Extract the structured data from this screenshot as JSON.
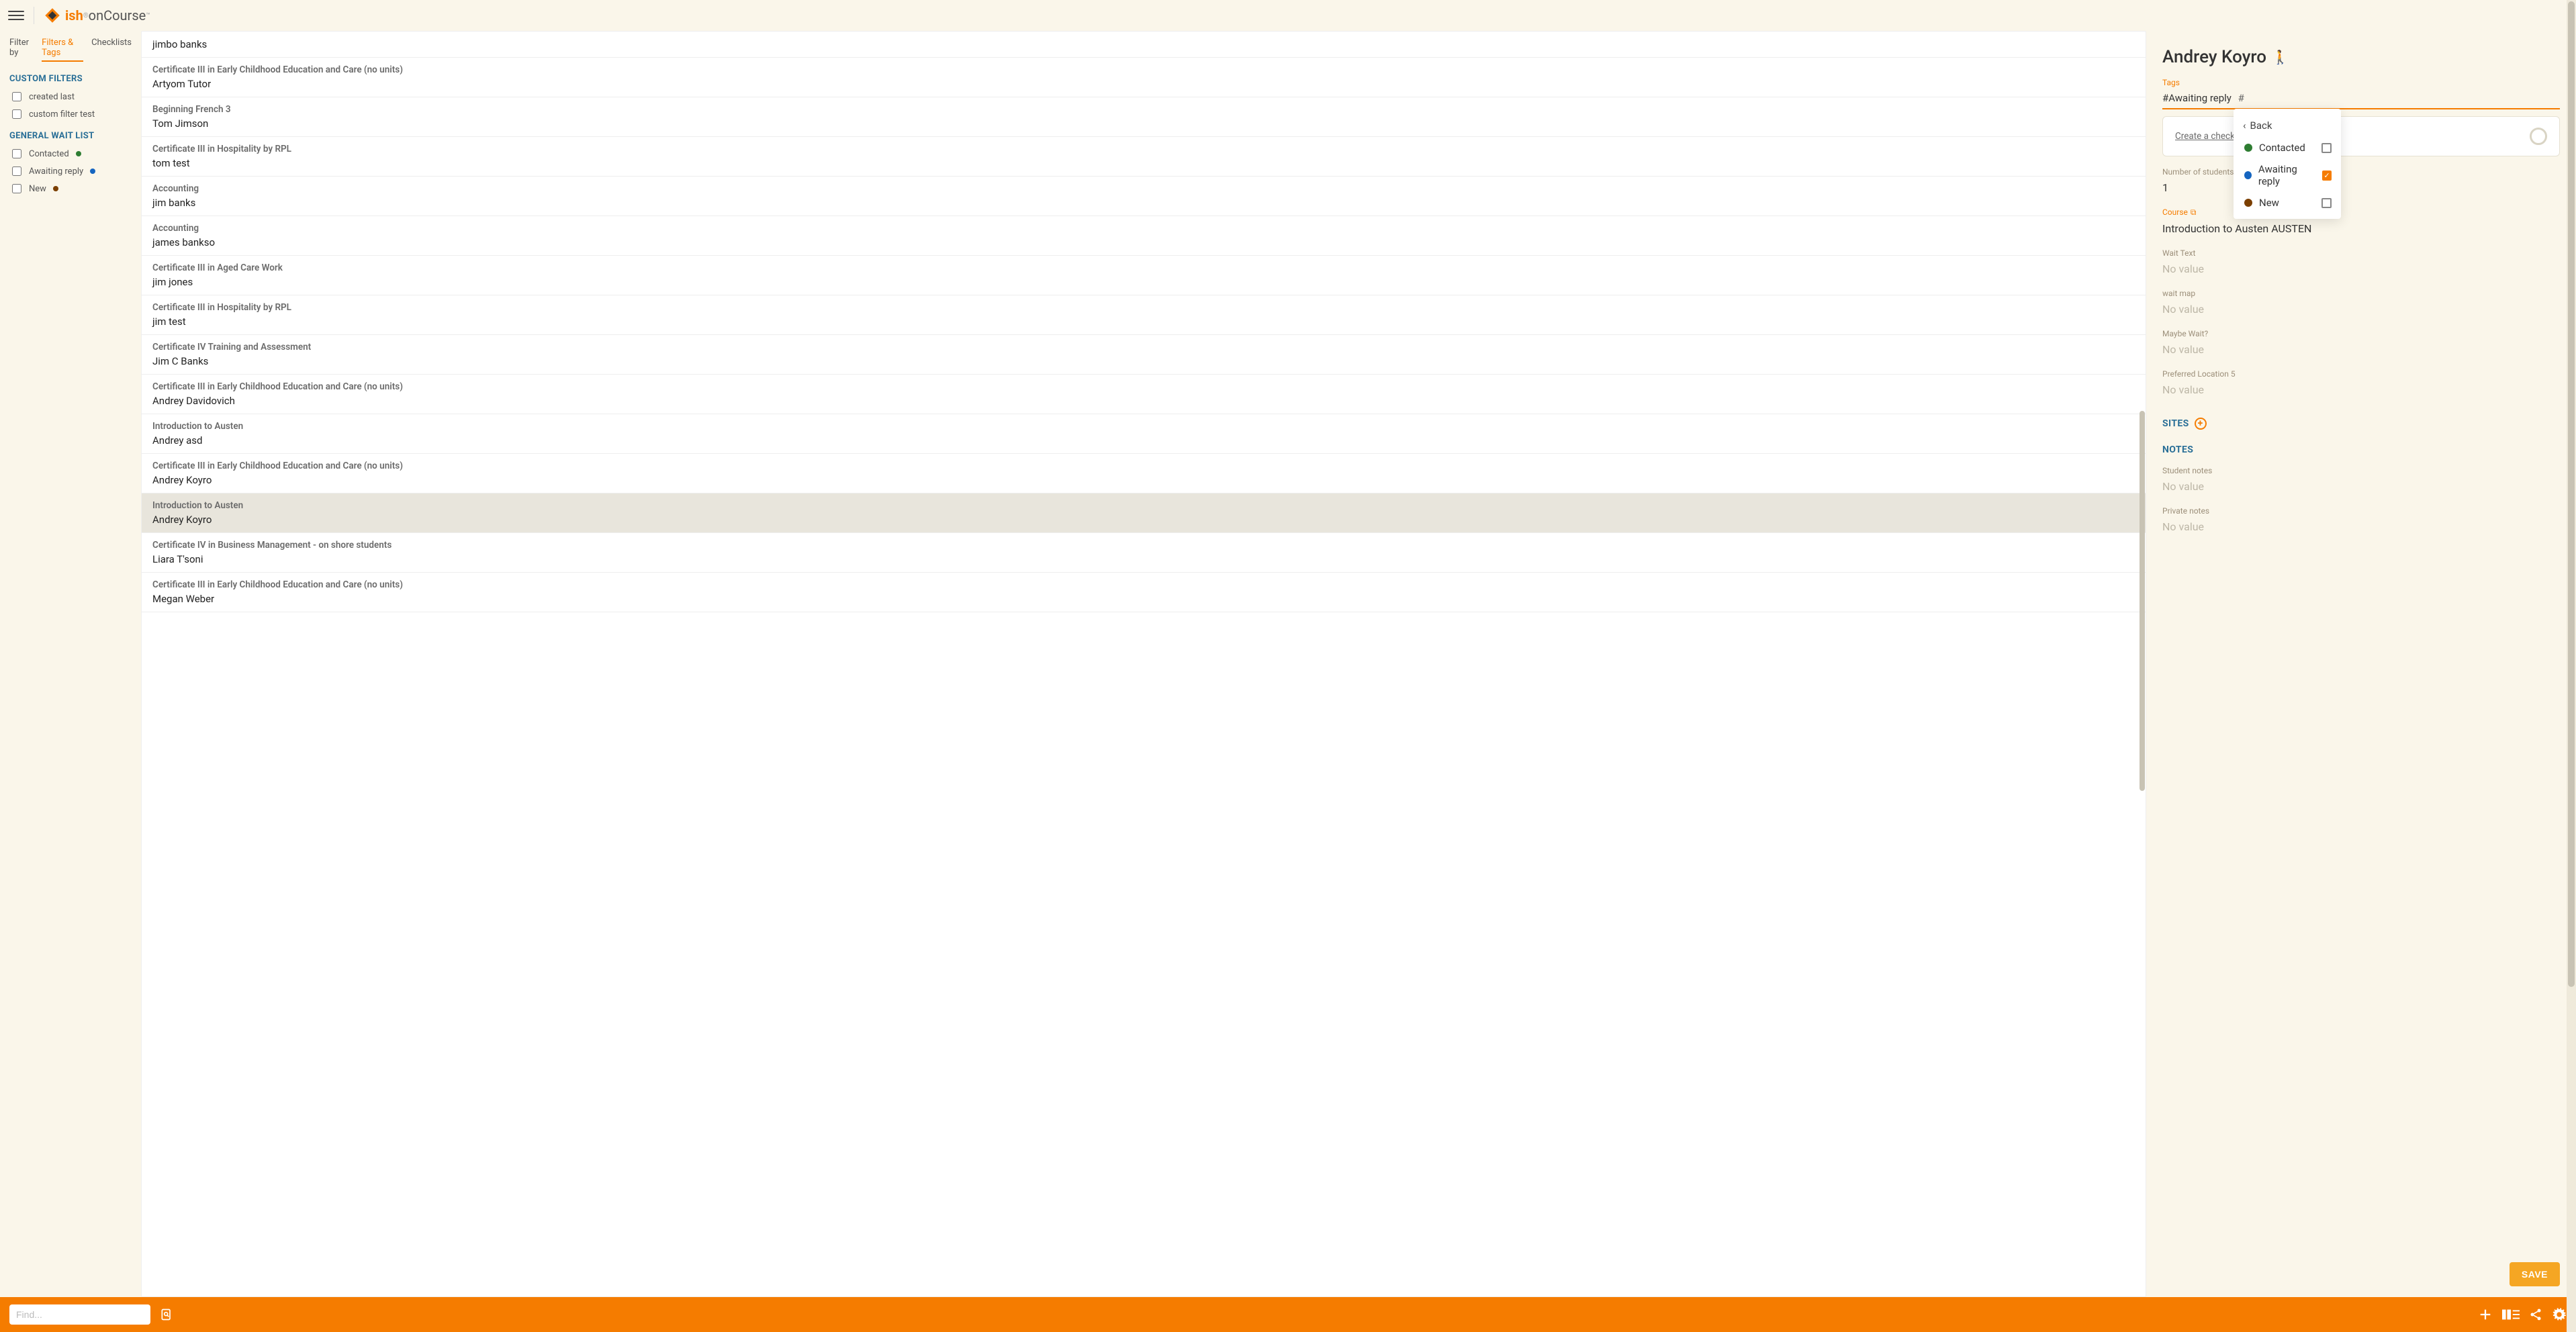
{
  "logo": {
    "brand": "ish",
    "product": "onCourse"
  },
  "filterTabs": {
    "label": "Filter by",
    "tab1": "Filters & Tags",
    "tab2": "Checklists"
  },
  "customFilters": {
    "title": "CUSTOM FILTERS",
    "items": [
      "created last",
      "custom filter test"
    ]
  },
  "generalWaitList": {
    "title": "GENERAL WAIT LIST",
    "items": [
      {
        "label": "Contacted",
        "color": "green"
      },
      {
        "label": "Awaiting reply",
        "color": "blue"
      },
      {
        "label": "New",
        "color": "brown"
      }
    ]
  },
  "rows": [
    {
      "course": "",
      "contact": "jimbo banks"
    },
    {
      "course": "Certificate III in Early Childhood Education and Care (no units)",
      "contact": "Artyom Tutor"
    },
    {
      "course": "Beginning French 3",
      "contact": "Tom Jimson"
    },
    {
      "course": "Certificate III in Hospitality by RPL",
      "contact": "tom test"
    },
    {
      "course": "Accounting",
      "contact": "jim banks"
    },
    {
      "course": "Accounting",
      "contact": "james bankso"
    },
    {
      "course": "Certificate III in Aged Care Work",
      "contact": "jim jones"
    },
    {
      "course": "Certificate III in Hospitality by RPL",
      "contact": "jim test"
    },
    {
      "course": "Certificate IV Training and Assessment",
      "contact": "Jim C Banks"
    },
    {
      "course": "Certificate III in Early Childhood Education and Care (no units)",
      "contact": "Andrey Davidovich"
    },
    {
      "course": "Introduction to Austen",
      "contact": "Andrey asd"
    },
    {
      "course": "Certificate III in Early Childhood Education and Care (no units)",
      "contact": "Andrey Koyro"
    },
    {
      "course": "Introduction to Austen",
      "contact": "Andrey Koyro",
      "selected": true
    },
    {
      "course": "Certificate IV in Business Management - on shore students",
      "contact": "Liara T'soni"
    },
    {
      "course": "Certificate III in Early Childhood Education and Care (no units)",
      "contact": "Megan Weber"
    }
  ],
  "detail": {
    "name": "Andrey Koyro",
    "tagsLabel": "Tags",
    "tagsValue": "#Awaiting reply",
    "tagsTrailing": "#",
    "checklistPrompt": "Create a checklist n",
    "numStudentsLabel": "Number of students",
    "numStudents": "1",
    "courseLabel": "Course",
    "courseValue": "Introduction to Austen AUSTEN",
    "fields": [
      {
        "label": "Wait Text",
        "value": "No value"
      },
      {
        "label": "wait map",
        "value": "No value"
      },
      {
        "label": "Maybe Wait?",
        "value": "No value"
      },
      {
        "label": "Preferred Location 5",
        "value": "No value"
      }
    ],
    "sitesHeader": "SITES",
    "notesHeader": "NOTES",
    "studentNotesLabel": "Student notes",
    "studentNotesValue": "No value",
    "privateNotesLabel": "Private notes",
    "privateNotesValue": "No value",
    "saveLabel": "SAVE"
  },
  "tagDropdown": {
    "back": "Back",
    "items": [
      {
        "label": "Contacted",
        "color": "green",
        "checked": false
      },
      {
        "label": "Awaiting reply",
        "color": "blue",
        "checked": true
      },
      {
        "label": "New",
        "color": "brown",
        "checked": false
      }
    ]
  },
  "footer": {
    "searchPlaceholder": "Find..."
  }
}
